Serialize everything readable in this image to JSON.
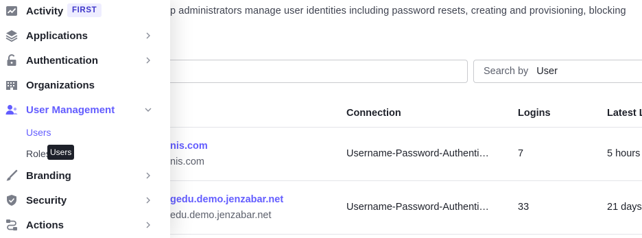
{
  "page": {
    "description": "p administrators manage user identities including password resets, creating and provisioning, blocking"
  },
  "search": {
    "input_value": "",
    "search_by_label": "Search by",
    "search_by_value": "User"
  },
  "table": {
    "headers": [
      "Connection",
      "Logins",
      "Latest L"
    ],
    "rows": [
      {
        "name": "nis.com",
        "email": "nis.com",
        "connection": "Username-Password-Authenti…",
        "logins": "7",
        "latest": "5 hours"
      },
      {
        "name": "gedu.demo.jenzabar.net",
        "email": "edu.demo.jenzabar.net",
        "connection": "Username-Password-Authenti…",
        "logins": "33",
        "latest": "21 days"
      }
    ]
  },
  "sidebar": {
    "items": [
      {
        "label": "Activity",
        "badge": "FIRST",
        "icon": "activity-chart-icon"
      },
      {
        "label": "Applications",
        "icon": "layers-icon"
      },
      {
        "label": "Authentication",
        "icon": "lock-icon"
      },
      {
        "label": "Organizations",
        "icon": "building-icon"
      },
      {
        "label": "User Management",
        "icon": "users-icon"
      },
      {
        "label": "Branding",
        "icon": "brush-icon"
      },
      {
        "label": "Security",
        "icon": "shield-icon"
      },
      {
        "label": "Actions",
        "icon": "actions-flow-icon"
      }
    ],
    "user_management_sub": [
      "Users",
      "Roles"
    ]
  },
  "tooltip": {
    "text": "Users"
  },
  "colors": {
    "accent": "#635dff",
    "badge_bg": "#eeedff",
    "text": "#1e212a",
    "muted": "#5c606c"
  }
}
